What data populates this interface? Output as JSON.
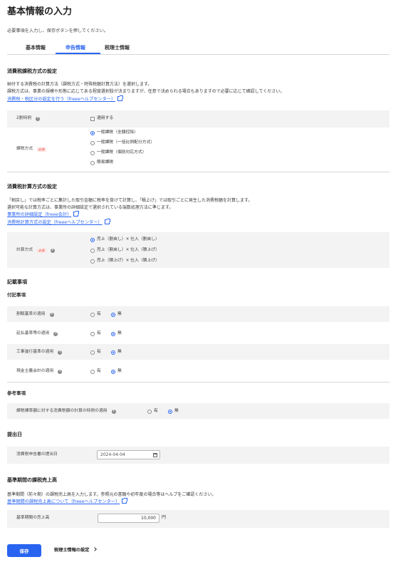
{
  "page": {
    "title": "基本情報の入力",
    "intro": "必要事項を入力し、保存ボタンを押してください。"
  },
  "tabs": [
    {
      "label": "基本情報",
      "active": false
    },
    {
      "label": "申告情報",
      "active": true
    },
    {
      "label": "税理士情報",
      "active": false
    }
  ],
  "tax_method": {
    "heading": "消費税課税方式の設定",
    "desc1": "納付する消費税の計算方法（課税方式・特殊税額計算方法）を選択します。",
    "desc2": "課税方式は、事業の規模や形態に応じてある程度選択肢が決まりますが、任意で決められる場合もありますので必要に応じて確認してください。",
    "help_link": "消費税・税区分の設定を行う（freeeヘルプセンター）",
    "exception": {
      "label": "2割特例",
      "option": "適用する",
      "checked": false
    },
    "method": {
      "label": "課税方式",
      "required_badge": "必須",
      "options": [
        {
          "label": "一般課税（全額控除）",
          "selected": true
        },
        {
          "label": "一般課税（一括比例配分方式）",
          "selected": false
        },
        {
          "label": "一般課税（個別対応方式）",
          "selected": false
        },
        {
          "label": "簡易課税",
          "selected": false
        }
      ]
    }
  },
  "calc_method": {
    "heading": "消費税計算方式の設定",
    "desc1": "「割戻し」では税率ごとに集計した取引金額に税率を掛けて計算し、「積上げ」では取引ごとに発生した消費税額を計算します。",
    "desc2": "選択可能な計算方式は、事業所の詳細設定で選択されている端数処理方法に準じます。",
    "link1": "事業所の詳細設定（freee会計）",
    "link2": "消費税計算方式の設定（freeeヘルプセンター）",
    "field": {
      "label": "計算方式",
      "required_badge": "必須",
      "options": [
        {
          "label": "売上（割戻し）× 仕入（割戻し）",
          "selected": true
        },
        {
          "label": "売上（割戻し）× 仕入（積上げ）",
          "selected": false
        },
        {
          "label": "売上（積上げ）× 仕入（積上げ）",
          "selected": false
        }
      ]
    }
  },
  "notes": {
    "heading": "記載事項",
    "attached_heading": "付記事項",
    "attached_items": [
      {
        "label": "割賦基準の適用",
        "yes": "有",
        "no": "無",
        "value": "無"
      },
      {
        "label": "延払基準等の適用",
        "yes": "有",
        "no": "無",
        "value": "無"
      },
      {
        "label": "工事進行基準の適用",
        "yes": "有",
        "no": "無",
        "value": "無"
      },
      {
        "label": "現金主義会計の適用",
        "yes": "有",
        "no": "無",
        "value": "無"
      }
    ],
    "reference_heading": "参考事項",
    "reference_items": [
      {
        "label": "課税標準額に対する消費税額の計算の特例の適用",
        "yes": "有",
        "no": "無",
        "value": "無"
      }
    ]
  },
  "submission": {
    "heading": "提出日",
    "label": "消費税申告書の提出日",
    "date": "2024-04-04"
  },
  "base_period": {
    "heading": "基準期間の課税売上高",
    "desc": "基準期間（前々期）の課税売上高を入力します。参照元の書類や初年度の場合等はヘルプをご確認ください。",
    "link": "基準期間の課税売上高について（freeeヘルプセンター）",
    "label": "基準期間の売上高",
    "value": "10,000",
    "unit": "円"
  },
  "footer": {
    "save_label": "保存",
    "next_label": "税理士情報の設定"
  },
  "colors": {
    "accent": "#2864f0",
    "row_bg": "#f3f3f3",
    "required": "#e8463c"
  }
}
